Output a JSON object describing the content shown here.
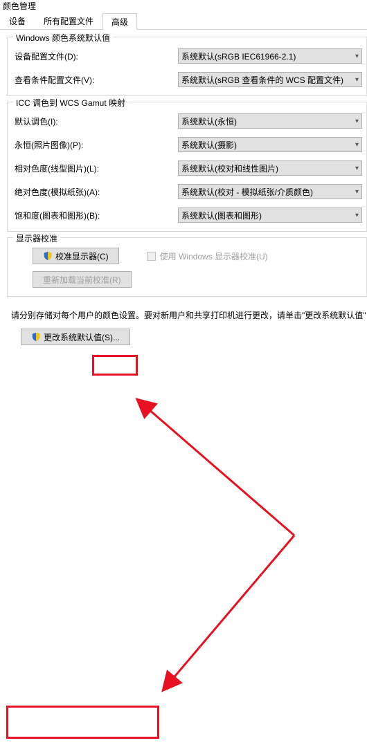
{
  "window": {
    "title": "颜色管理"
  },
  "tabs": {
    "devices": "设备",
    "profiles": "所有配置文件",
    "advanced": "高级"
  },
  "group_defaults": {
    "title": "Windows 颜色系统默认值",
    "device_profile_label": "设备配置文件(D):",
    "device_profile_value": "系统默认(sRGB IEC61966-2.1)",
    "viewing_conditions_label": "查看条件配置文件(V):",
    "viewing_conditions_value": "系统默认(sRGB 查看条件的 WCS 配置文件)"
  },
  "group_gamut": {
    "title": "ICC 调色到 WCS Gamut 映射",
    "default_intent_label": "默认调色(I):",
    "default_intent_value": "系统默认(永恒)",
    "perceptual_label": "永恒(照片图像)(P):",
    "perceptual_value": "系统默认(摄影)",
    "relative_label": "相对色度(线型图片)(L):",
    "relative_value": "系统默认(校对和线性图片)",
    "absolute_label": "绝对色度(模拟纸张)(A):",
    "absolute_value": "系统默认(校对 - 模拟纸张/介质颜色)",
    "saturation_label": "饱和度(图表和图形)(B):",
    "saturation_value": "系统默认(图表和图形)"
  },
  "group_calib": {
    "title": "显示器校准",
    "calibrate_btn": "校准显示器(C)",
    "use_windows_calib": "使用 Windows 显示器校准(U)",
    "reload_btn": "重新加载当前校准(R)"
  },
  "note": "请分别存储对每个用户的颜色设置。要对新用户和共享打印机进行更改，请单击\"更改系统默认值\"",
  "change_defaults_btn": "更改系统默认值(S)..."
}
